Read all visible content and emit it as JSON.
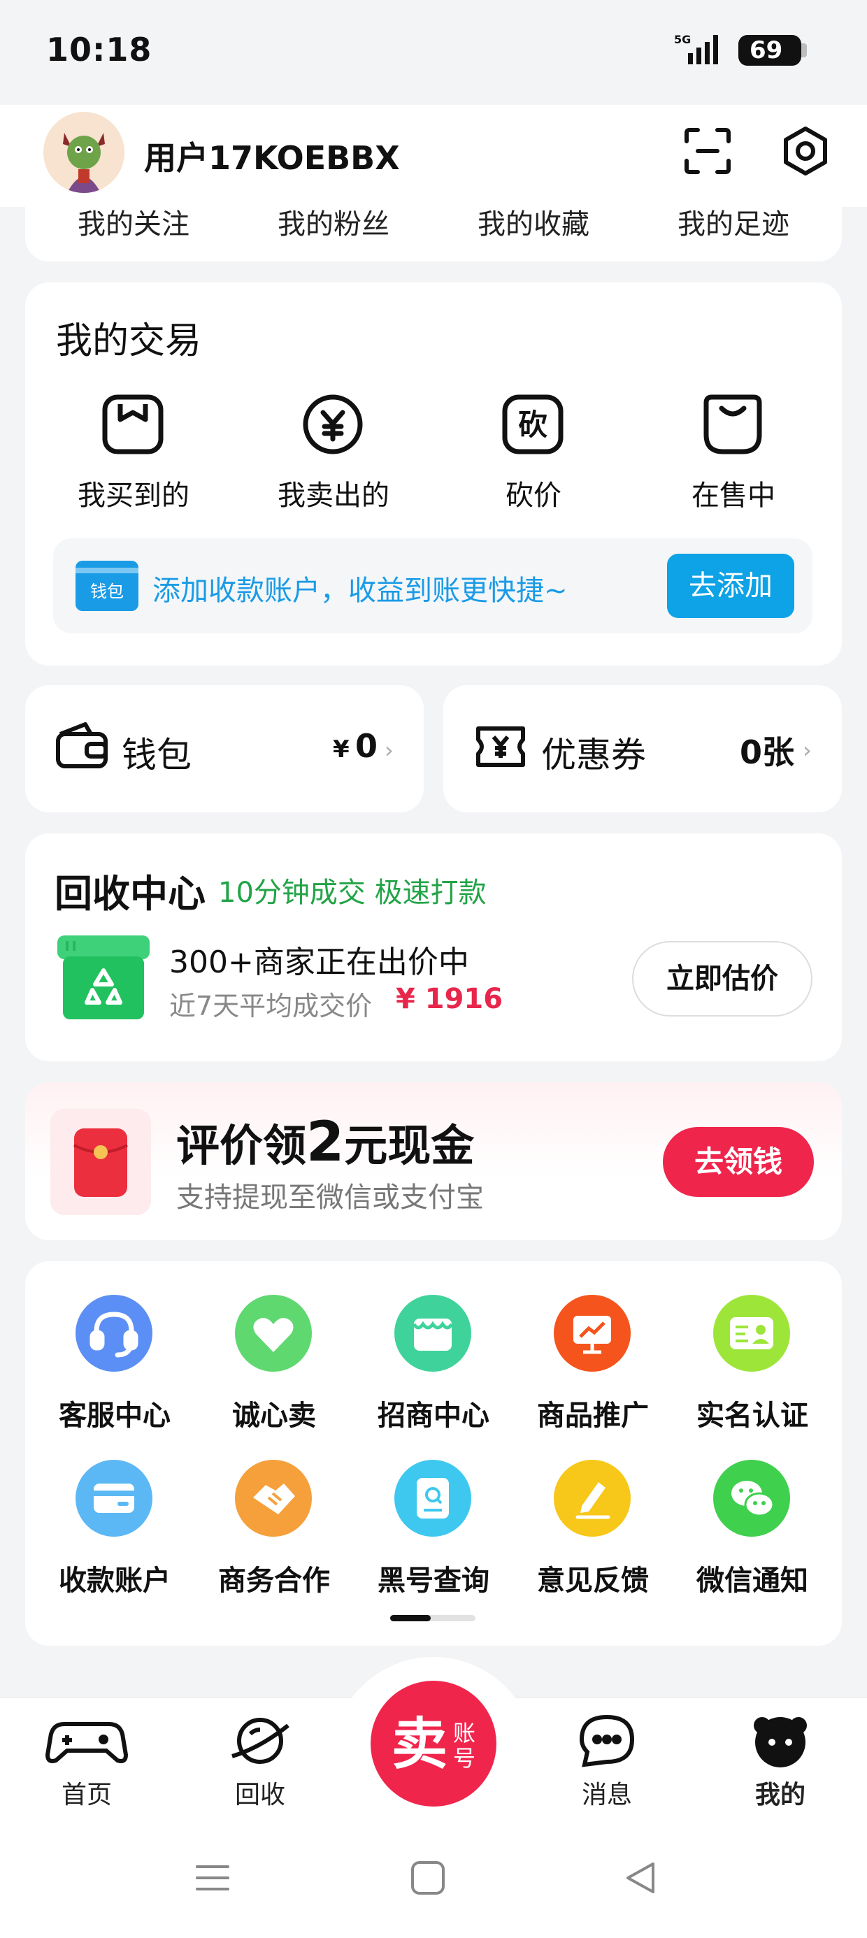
{
  "status_bar": {
    "time": "10:18",
    "network": "5G",
    "battery": "69"
  },
  "profile": {
    "username": "用户17KOEBBX"
  },
  "social": [
    {
      "label": "我的关注"
    },
    {
      "label": "我的粉丝"
    },
    {
      "label": "我的收藏"
    },
    {
      "label": "我的足迹"
    }
  ],
  "trade": {
    "title": "我的交易",
    "items": [
      {
        "label": "我买到的",
        "icon": "bag-icon"
      },
      {
        "label": "我卖出的",
        "icon": "yuan-icon"
      },
      {
        "label": "砍价",
        "icon": "bargain-icon",
        "glyph": "砍"
      },
      {
        "label": "在售中",
        "icon": "on-sale-icon"
      }
    ],
    "payment_prompt": {
      "badge": "钱包",
      "text": "添加收款账户，收益到账更快捷~",
      "button": "去添加"
    }
  },
  "wallet": {
    "label": "钱包",
    "currency": "¥",
    "amount": "0"
  },
  "coupons": {
    "label": "优惠券",
    "count": "0张"
  },
  "recycle": {
    "title": "回收中心",
    "slogan": "10分钟成交 极速打款",
    "headline": "300+商家正在出价中",
    "sub": "近7天平均成交价",
    "price": "¥ 1916",
    "button": "立即估价"
  },
  "cash_promo": {
    "title_pre": "评价领",
    "title_num": "2",
    "title_post": "元现金",
    "sub": "支持提现至微信或支付宝",
    "button": "去领钱"
  },
  "services": [
    {
      "label": "客服中心",
      "icon": "headset-icon",
      "color": "#5b8ff5"
    },
    {
      "label": "诚心卖",
      "icon": "heart-icon",
      "color": "#5fd870"
    },
    {
      "label": "招商中心",
      "icon": "store-icon",
      "color": "#3fd39b"
    },
    {
      "label": "商品推广",
      "icon": "promotion-icon",
      "color": "#f5541c"
    },
    {
      "label": "实名认证",
      "icon": "id-card-icon",
      "color": "#9ee53a"
    },
    {
      "label": "收款账户",
      "icon": "card-icon",
      "color": "#5cb8f5"
    },
    {
      "label": "商务合作",
      "icon": "handshake-icon",
      "color": "#f5a03a"
    },
    {
      "label": "黑号查询",
      "icon": "search-book-icon",
      "color": "#3fc8ef"
    },
    {
      "label": "意见反馈",
      "icon": "edit-icon",
      "color": "#f7c719"
    },
    {
      "label": "微信通知",
      "icon": "wechat-icon",
      "color": "#3fd04e"
    }
  ],
  "tabbar": {
    "items": [
      {
        "label": "首页",
        "icon": "gamepad-icon"
      },
      {
        "label": "回收",
        "icon": "planet-icon"
      },
      {
        "label": "消息",
        "icon": "chat-icon"
      },
      {
        "label": "我的",
        "icon": "profile-face-icon"
      }
    ],
    "sell": {
      "main": "卖",
      "sub1": "账",
      "sub2": "号"
    }
  },
  "colors": {
    "accent_blue": "#0ea2e6",
    "accent_red": "#f0254c",
    "recycle_green": "#22a447"
  }
}
